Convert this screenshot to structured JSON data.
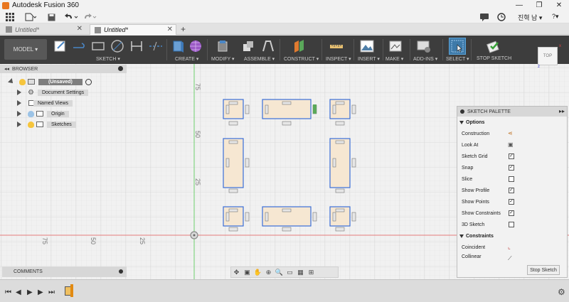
{
  "window": {
    "title": "Autodesk Fusion 360",
    "controls": [
      "—",
      "❐",
      "✕"
    ]
  },
  "qat": {
    "user": "진혁 남 ▾",
    "help": "?▾"
  },
  "tabs": [
    {
      "label": "Untitled*",
      "active": false
    },
    {
      "label": "Untitled*",
      "active": true
    }
  ],
  "toolbar": {
    "workspace": "MODEL ▾",
    "groups": [
      {
        "label": "SKETCH ▾"
      },
      {
        "label": "CREATE ▾"
      },
      {
        "label": "MODIFY ▾"
      },
      {
        "label": "ASSEMBLE ▾"
      },
      {
        "label": "CONSTRUCT ▾"
      },
      {
        "label": "INSPECT ▾"
      },
      {
        "label": "INSERT ▾"
      },
      {
        "label": "MAKE ▾"
      },
      {
        "label": "ADD-INS ▾"
      },
      {
        "label": "SELECT ▾"
      },
      {
        "label": "STOP SKETCH"
      }
    ]
  },
  "viewcube": {
    "label": "TOP",
    "axis_x": "x",
    "axis_z": "z"
  },
  "browser": {
    "title": "BROWSER",
    "items": [
      {
        "label": "(Unsaved)"
      },
      {
        "label": "Document Settings"
      },
      {
        "label": "Named Views"
      },
      {
        "label": "Origin"
      },
      {
        "label": "Sketches"
      }
    ]
  },
  "comments": {
    "title": "COMMENTS"
  },
  "axis_labels": {
    "vertical": [
      "75",
      "50",
      "25"
    ],
    "horizontal": [
      "75",
      "50",
      "25"
    ]
  },
  "palette": {
    "title": "SKETCH PALETTE",
    "options_heading": "Options",
    "options": [
      {
        "label": "Construction",
        "type": "icon",
        "checked": false
      },
      {
        "label": "Look At",
        "type": "icon",
        "checked": false
      },
      {
        "label": "Sketch Grid",
        "type": "check",
        "checked": true
      },
      {
        "label": "Snap",
        "type": "check",
        "checked": true
      },
      {
        "label": "Slice",
        "type": "check",
        "checked": false
      },
      {
        "label": "Show Profile",
        "type": "check",
        "checked": true
      },
      {
        "label": "Show Points",
        "type": "check",
        "checked": true
      },
      {
        "label": "Show Constraints",
        "type": "check",
        "checked": true
      },
      {
        "label": "3D Sketch",
        "type": "check",
        "checked": false
      }
    ],
    "constraints_heading": "Constraints",
    "constraints": [
      {
        "label": "Coincident"
      },
      {
        "label": "Collinear"
      }
    ],
    "stop_button": "Stop Sketch"
  },
  "colors": {
    "accent": "#3e7aa9",
    "profile_fill": "#f6e7d2",
    "profile_stroke": "#3a6fd8",
    "x_axis": "#e57a7a",
    "y_axis": "#6ccf6c"
  }
}
